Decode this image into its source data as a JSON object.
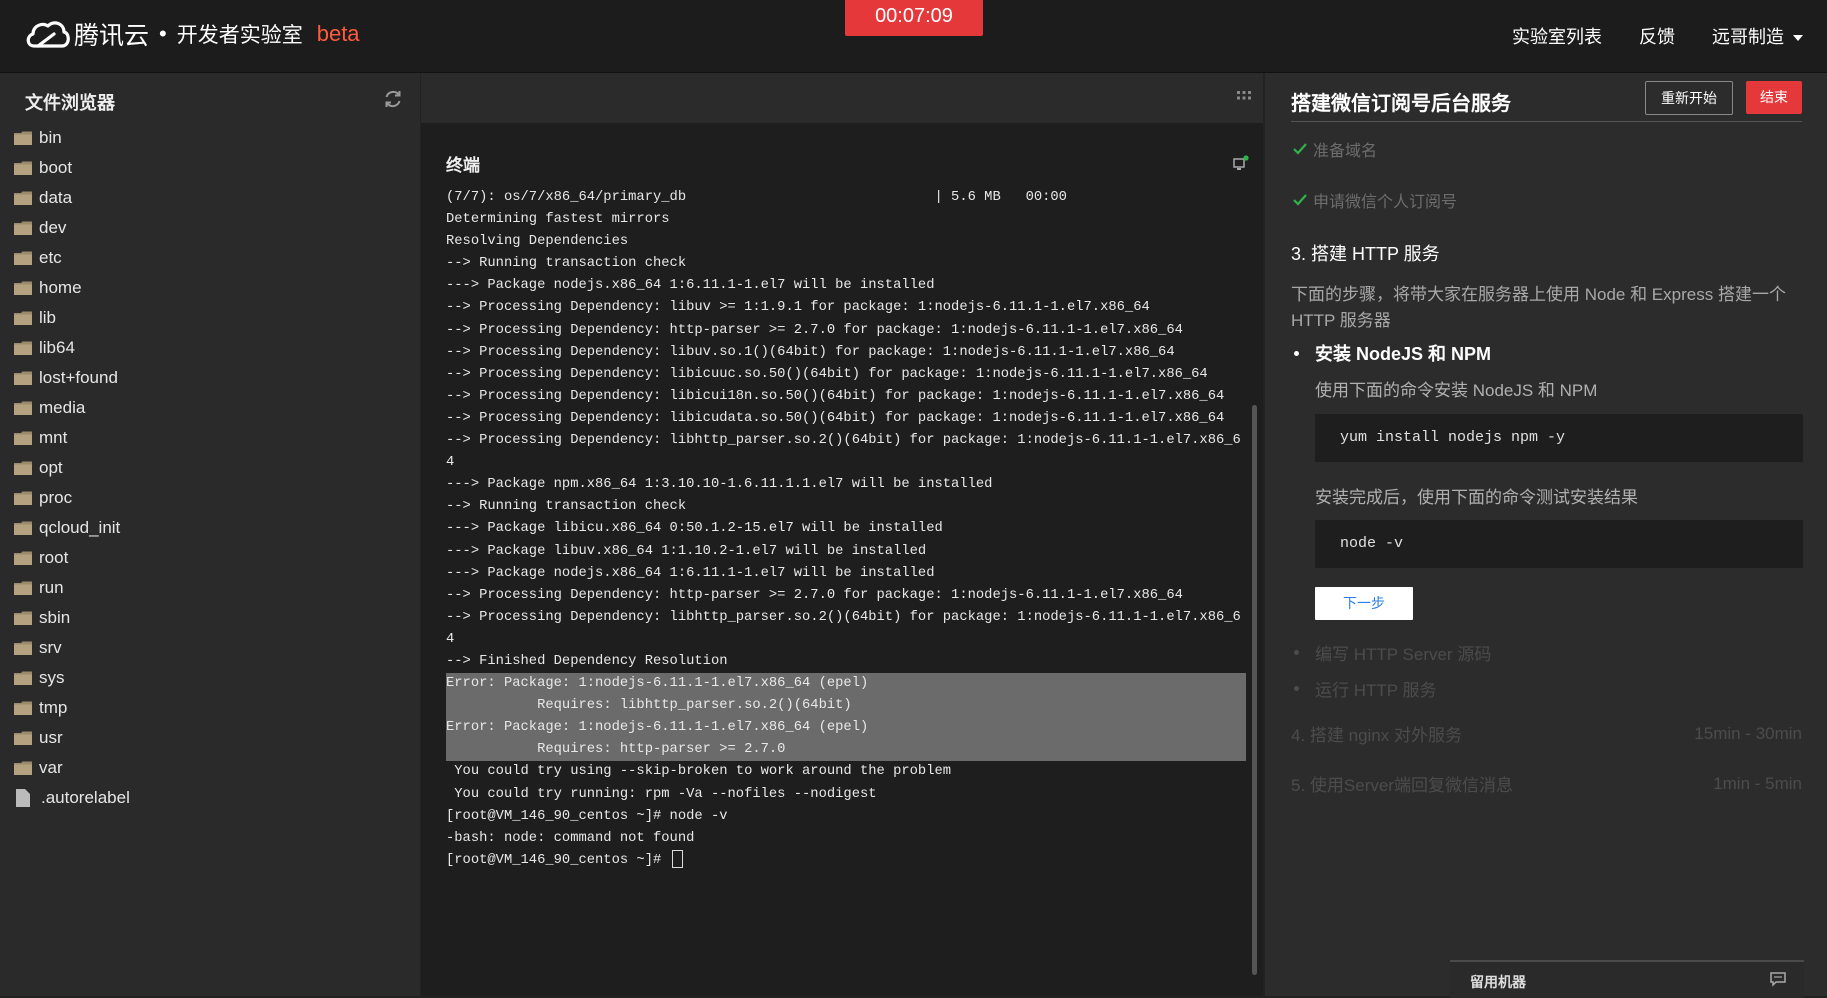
{
  "header": {
    "brand": "腾讯云",
    "separator": "•",
    "lab_title": "开发者实验室",
    "beta": "beta",
    "timer": "00:07:09",
    "nav": [
      "实验室列表",
      "反馈",
      "远哥制造"
    ]
  },
  "sidebar": {
    "title": "文件浏览器",
    "folders": [
      "bin",
      "boot",
      "data",
      "dev",
      "etc",
      "home",
      "lib",
      "lib64",
      "lost+found",
      "media",
      "mnt",
      "opt",
      "proc",
      "qcloud_init",
      "root",
      "run",
      "sbin",
      "srv",
      "sys",
      "tmp",
      "usr",
      "var"
    ],
    "files": [
      ".autorelabel"
    ]
  },
  "terminal": {
    "title": "终端",
    "lines_before": [
      "(7/7): os/7/x86_64/primary_db                              | 5.6 MB   00:00",
      "Determining fastest mirrors",
      "Resolving Dependencies",
      "--> Running transaction check",
      "---> Package nodejs.x86_64 1:6.11.1-1.el7 will be installed",
      "--> Processing Dependency: libuv >= 1:1.9.1 for package: 1:nodejs-6.11.1-1.el7.x86_64",
      "--> Processing Dependency: http-parser >= 2.7.0 for package: 1:nodejs-6.11.1-1.el7.x86_64",
      "--> Processing Dependency: libuv.so.1()(64bit) for package: 1:nodejs-6.11.1-1.el7.x86_64",
      "--> Processing Dependency: libicuuc.so.50()(64bit) for package: 1:nodejs-6.11.1-1.el7.x86_64",
      "--> Processing Dependency: libicui18n.so.50()(64bit) for package: 1:nodejs-6.11.1-1.el7.x86_64",
      "--> Processing Dependency: libicudata.so.50()(64bit) for package: 1:nodejs-6.11.1-1.el7.x86_64",
      "--> Processing Dependency: libhttp_parser.so.2()(64bit) for package: 1:nodejs-6.11.1-1.el7.x86_64",
      "---> Package npm.x86_64 1:3.10.10-1.6.11.1.1.el7 will be installed",
      "--> Running transaction check",
      "---> Package libicu.x86_64 0:50.1.2-15.el7 will be installed",
      "---> Package libuv.x86_64 1:1.10.2-1.el7 will be installed",
      "---> Package nodejs.x86_64 1:6.11.1-1.el7 will be installed",
      "--> Processing Dependency: http-parser >= 2.7.0 for package: 1:nodejs-6.11.1-1.el7.x86_64",
      "--> Processing Dependency: libhttp_parser.so.2()(64bit) for package: 1:nodejs-6.11.1-1.el7.x86_64",
      "--> Finished Dependency Resolution"
    ],
    "lines_error": [
      "Error: Package: 1:nodejs-6.11.1-1.el7.x86_64 (epel)",
      "           Requires: libhttp_parser.so.2()(64bit)",
      "Error: Package: 1:nodejs-6.11.1-1.el7.x86_64 (epel)",
      "           Requires: http-parser >= 2.7.0"
    ],
    "lines_after": [
      " You could try using --skip-broken to work around the problem",
      " You could try running: rpm -Va --nofiles --nodigest",
      "[root@VM_146_90_centos ~]# node -v",
      "-bash: node: command not found",
      "[root@VM_146_90_centos ~]# "
    ]
  },
  "panel": {
    "title": "搭建微信订阅号后台服务",
    "restart_label": "重新开始",
    "end_label": "结束",
    "done_steps": [
      "准备域名",
      "申请微信个人订阅号"
    ],
    "current_step": "3. 搭建 HTTP 服务",
    "current_desc": "下面的步骤，将带大家在服务器上使用 Node 和 Express 搭建一个 HTTP 服务器",
    "sub_title": "安装 NodeJS 和 NPM",
    "sub_desc1": "使用下面的命令安装 NodeJS 和 NPM",
    "code1": "yum install nodejs npm -y",
    "sub_desc2": "安装完成后，使用下面的命令测试安装结果",
    "code2": "node -v",
    "next_label": "下一步",
    "future_substeps": [
      "编写 HTTP Server 源码",
      "运行 HTTP 服务"
    ],
    "future_steps": [
      {
        "label": "4. 搭建 nginx 对外服务",
        "duration": "15min - 30min"
      },
      {
        "label": "5. 使用Server端回复微信消息",
        "duration": "1min - 5min"
      }
    ],
    "keep_machine": "留用机器"
  },
  "colors": {
    "accent_red": "#e5383b",
    "beta_orange": "#ff5a3c",
    "check_green": "#2fb34a",
    "next_blue": "#2b7de9"
  }
}
